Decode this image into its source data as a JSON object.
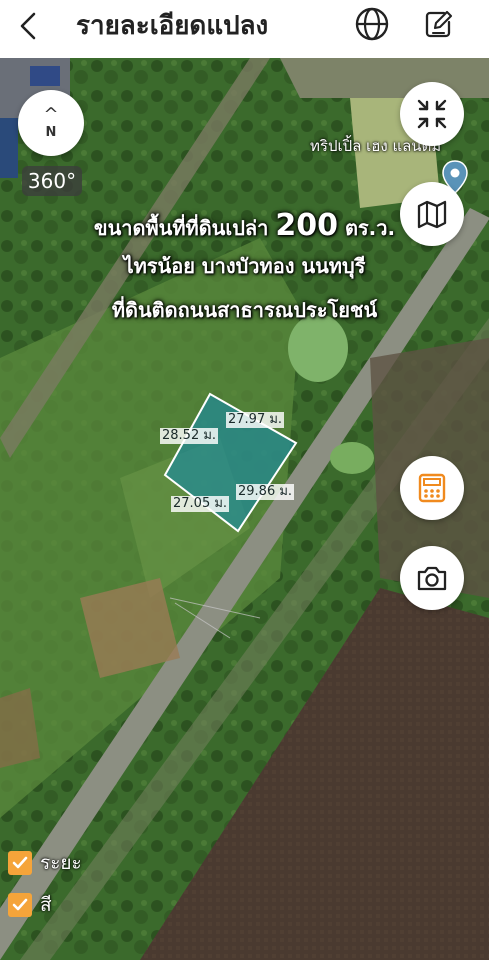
{
  "header": {
    "title": "รายละเอียดแปลง"
  },
  "map": {
    "compass_label": "N",
    "view_360_label": "360°",
    "place_label": "ทริปเปิ้ล เฮง แลนด์ม",
    "ad_line1_prefix": "ขนาดพื้นที่ที่ดินเปล่า",
    "ad_line1_size": "200",
    "ad_line1_unit": "ตร.ว.",
    "ad_line2": "ไทรน้อย บางบัวทอง นนทบุรี",
    "ad_line3": "ที่ดินติดถนนสาธารณประโยชน์",
    "plot_dimensions": [
      "27.97 ม.",
      "28.52 ม.",
      "29.86 ม.",
      "27.05 ม."
    ],
    "plot_fill_color": "#1f8a9a"
  },
  "legend": {
    "items": [
      {
        "label": "ระยะ",
        "checked": true
      },
      {
        "label": "สี",
        "checked": true
      }
    ],
    "check_color": "#f5a43a"
  },
  "icons": {
    "back": "back-arrow-icon",
    "globe": "globe-icon",
    "edit": "edit-icon",
    "collapse": "collapse-icon",
    "map_layers": "map-icon",
    "measure": "measure-icon",
    "camera": "camera-icon",
    "pin": "location-pin-icon"
  }
}
